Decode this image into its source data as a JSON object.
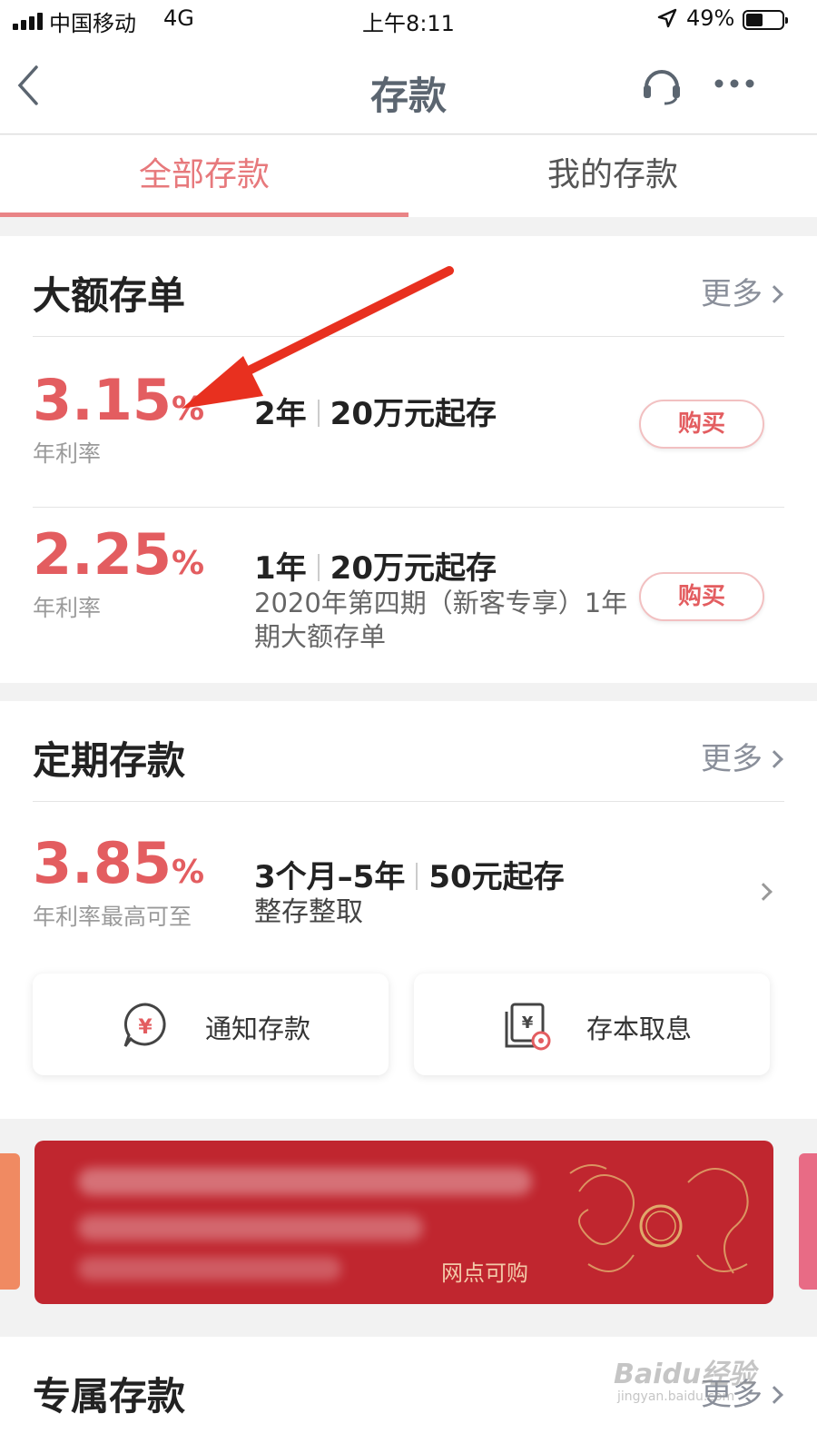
{
  "status_bar": {
    "carrier": "中国移动",
    "network": "4G",
    "time": "上午8:11",
    "battery": "49%"
  },
  "nav": {
    "title": "存款",
    "back_icon": "chevron-left-icon",
    "service_icon": "headset-icon",
    "more_icon": "more-dots-icon"
  },
  "tabs": [
    {
      "label": "全部存款",
      "active": true
    },
    {
      "label": "我的存款",
      "active": false
    }
  ],
  "large_cd": {
    "title": "大额存单",
    "more": "更多",
    "items": [
      {
        "rate": "3.15",
        "unit": "%",
        "rate_label": "年利率",
        "term": "2年",
        "min": "20万元起存",
        "desc": "",
        "button": "购买"
      },
      {
        "rate": "2.25",
        "unit": "%",
        "rate_label": "年利率",
        "term": "1年",
        "min": "20万元起存",
        "desc": "2020年第四期（新客专享）1年期大额存单",
        "button": "购买"
      }
    ]
  },
  "fixed": {
    "title": "定期存款",
    "more": "更多",
    "item": {
      "rate": "3.85",
      "unit": "%",
      "rate_label": "年利率最高可至",
      "term": "3个月–5年",
      "min": "50元起存",
      "desc": "整存整取"
    },
    "cards": [
      {
        "label": "通知存款",
        "icon": "yuan-bubble-icon"
      },
      {
        "label": "存本取息",
        "icon": "yuan-document-icon"
      }
    ]
  },
  "banner": {
    "subtitle": "网点可购"
  },
  "exclusive": {
    "title": "专属存款",
    "more": "更多"
  },
  "watermark": {
    "text": "Baidu经验",
    "url": "jingyan.baidu.com"
  },
  "colors": {
    "accent": "#e35d60",
    "tab_active": "#e7797c",
    "banner": "#c0262f"
  }
}
